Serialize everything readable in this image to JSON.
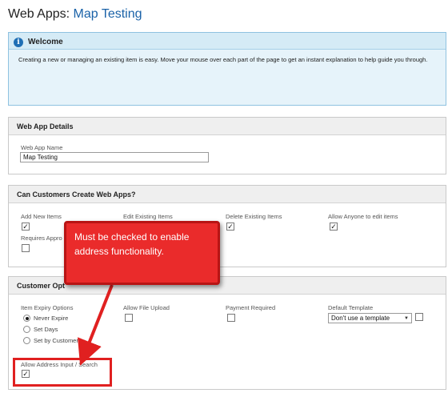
{
  "header": {
    "prefix": "Web Apps:",
    "name": "Map Testing"
  },
  "welcome": {
    "title": "Welcome",
    "icon": "info-icon",
    "text": "Creating a new or managing an existing item is easy. Move your mouse over each part of the page to get an instant explanation to help guide you through."
  },
  "details": {
    "title": "Web App Details",
    "name_label": "Web App Name",
    "name_value": "Map Testing"
  },
  "customers": {
    "title": "Can Customers Create Web Apps?",
    "add_new": {
      "label": "Add New Items",
      "checked": true
    },
    "edit_existing": {
      "label": "Edit Existing Items"
    },
    "delete_existing": {
      "label": "Delete Existing Items",
      "checked": true
    },
    "allow_anyone": {
      "label": "Allow Anyone to edit items",
      "checked": true
    },
    "requires_approval": {
      "label": "Requires Appro",
      "checked": false
    }
  },
  "options": {
    "title": "Customer Opt",
    "expiry": {
      "label": "Item Expiry Options",
      "choices": [
        "Never Expire",
        "Set Days",
        "Set by Customer"
      ],
      "selected": "Never Expire"
    },
    "file_upload": {
      "label": "Allow File Upload",
      "checked": false
    },
    "payment": {
      "label": "Payment Required",
      "checked": false
    },
    "template": {
      "label": "Default Template",
      "value": "Don't use a template"
    },
    "address": {
      "label": "Allow Address Input / Search",
      "checked": true
    }
  },
  "annotation": {
    "text": "Must be checked to enable address functionality.",
    "color": "#ea2b2b"
  },
  "check_glyph": "✓"
}
